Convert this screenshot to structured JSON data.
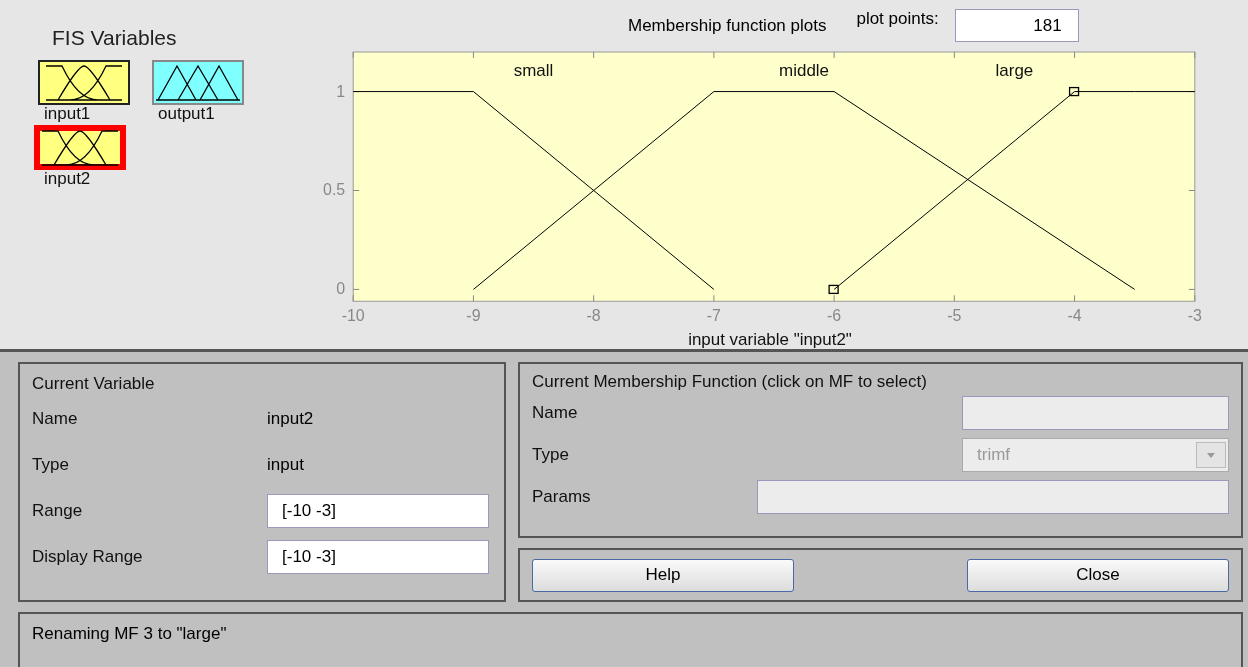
{
  "fis_variables": {
    "title": "FIS Variables",
    "items": [
      {
        "name": "input1",
        "kind": "input",
        "selected": false
      },
      {
        "name": "output1",
        "kind": "output",
        "selected": false
      },
      {
        "name": "input2",
        "kind": "input",
        "selected": true
      }
    ]
  },
  "plot": {
    "title": "Membership function plots",
    "points_label": "plot points:",
    "points_value": "181",
    "curves": [
      {
        "selected": false
      },
      {
        "selected": false
      },
      {
        "selected": true
      }
    ],
    "chart_data": {
      "type": "line",
      "xlabel": "input variable \"input2\"",
      "x": [
        -10,
        -9,
        -7,
        -6,
        -4,
        -3.5,
        -3
      ],
      "xlim": [
        -10,
        -3
      ],
      "ylim": [
        -0.06,
        1.2
      ],
      "xticks": [
        -10,
        -9,
        -8,
        -7,
        -6,
        -5,
        -4,
        -3
      ],
      "yticks": [
        0,
        0.5,
        1
      ],
      "series": [
        {
          "name": "small",
          "color": "#000000",
          "values": [
            1,
            1,
            0,
            null,
            null,
            null,
            null
          ]
        },
        {
          "name": "middle",
          "color": "#000000",
          "values": [
            null,
            0,
            1,
            1,
            0.2,
            0,
            null
          ]
        },
        {
          "name": "large",
          "color": "#000000",
          "values": [
            null,
            null,
            null,
            0,
            1,
            1,
            1
          ]
        }
      ]
    }
  },
  "current_variable": {
    "title": "Current Variable",
    "rows": [
      {
        "label": "Name",
        "kind": "text",
        "value": "input2"
      },
      {
        "label": "Type",
        "kind": "text",
        "value": "input"
      },
      {
        "label": "Range",
        "kind": "field",
        "value": "[-10 -3]"
      },
      {
        "label": "Display Range",
        "kind": "field",
        "value": "[-10 -3]"
      }
    ]
  },
  "current_mf": {
    "title": "Current Membership Function (click on MF to select)",
    "rows": [
      {
        "label": "Name",
        "kind": "field",
        "value": "",
        "disabled": true
      },
      {
        "label": "Type",
        "kind": "dropdown",
        "value": "trimf",
        "disabled": true
      },
      {
        "label": "Params",
        "kind": "wide_field",
        "value": "",
        "disabled": true
      }
    ]
  },
  "buttons": [
    "Help",
    "Close"
  ],
  "status": "Renaming MF 3 to \"large\""
}
